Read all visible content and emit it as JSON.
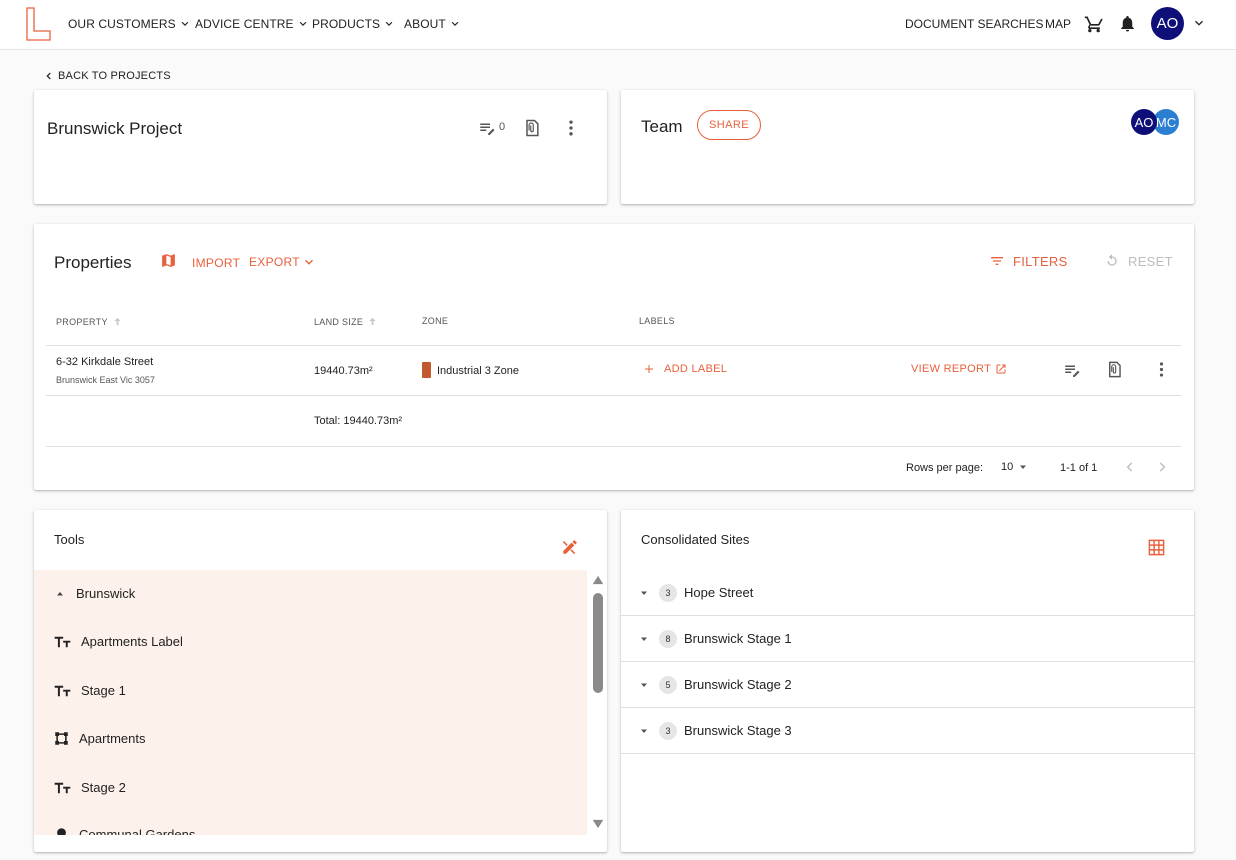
{
  "colors": {
    "accent": "#e8603c",
    "avatar_primary": "#0f0f7a",
    "avatar_secondary": "#2b7fd3",
    "zone_industrial": "#c1582f"
  },
  "nav": {
    "items": [
      "OUR CUSTOMERS",
      "ADVICE CENTRE",
      "PRODUCTS",
      "ABOUT"
    ],
    "document_searches": "DOCUMENT SEARCHES",
    "map": "MAP",
    "user_initials": "AO"
  },
  "back_link": "BACK TO PROJECTS",
  "project": {
    "title": "Brunswick Project",
    "notes_count": "0"
  },
  "team": {
    "title": "Team",
    "share_label": "SHARE",
    "members": [
      "AO",
      "MC"
    ]
  },
  "properties": {
    "title": "Properties",
    "import_label": "IMPORT",
    "export_label": "EXPORT",
    "filters_label": "FILTERS",
    "reset_label": "RESET",
    "columns": [
      "PROPERTY",
      "LAND SIZE",
      "ZONE",
      "LABELS"
    ],
    "rows": [
      {
        "address": "6-32 Kirkdale Street",
        "suburb": "Brunswick East Vic 3057",
        "land_size": "19440.73m²",
        "zone": "Industrial 3 Zone",
        "add_label": "ADD LABEL",
        "view_report": "VIEW REPORT"
      }
    ],
    "total": "Total: 19440.73m²",
    "rows_per_page_label": "Rows per page:",
    "rows_per_page": "10",
    "range": "1-1 of 1"
  },
  "tools": {
    "title": "Tools",
    "group": "Brunswick",
    "items": [
      {
        "icon": "text-icon",
        "label": "Apartments Label"
      },
      {
        "icon": "text-icon",
        "label": "Stage 1"
      },
      {
        "icon": "polygon-icon",
        "label": "Apartments"
      },
      {
        "icon": "text-icon",
        "label": "Stage 2"
      },
      {
        "icon": "pin-icon",
        "label": "Communal Gardens"
      }
    ]
  },
  "consolidated": {
    "title": "Consolidated Sites",
    "sites": [
      {
        "count": "3",
        "name": "Hope Street"
      },
      {
        "count": "8",
        "name": "Brunswick Stage 1"
      },
      {
        "count": "5",
        "name": "Brunswick Stage 2"
      },
      {
        "count": "3",
        "name": "Brunswick Stage 3"
      }
    ]
  }
}
